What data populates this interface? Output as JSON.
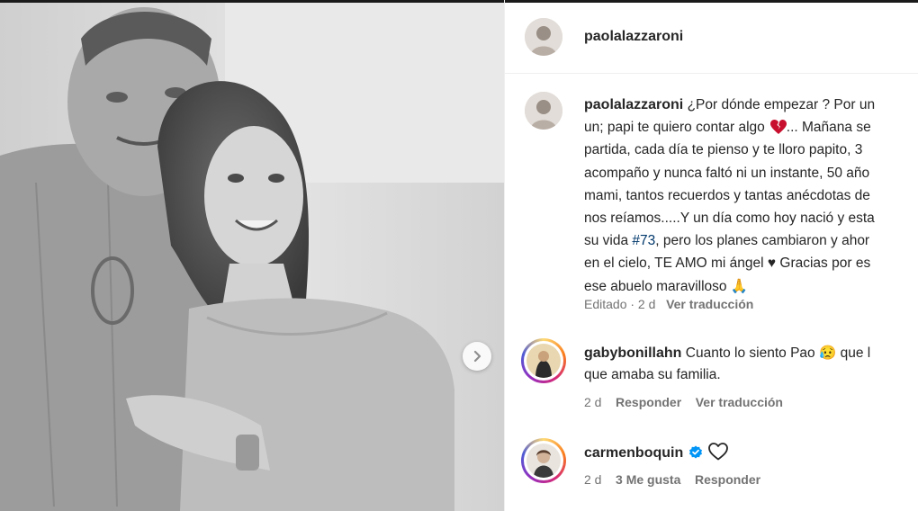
{
  "post": {
    "author": "paolalazzaroni",
    "photo_alt": "Black and white photo of a smiling woman leaning on an older man"
  },
  "caption": {
    "username": "paolalazzaroni",
    "lines": [
      "¿Por dónde empezar ? Por un",
      "un; papi te quiero contar algo",
      "partida, cada día te pienso y te lloro papito, 3",
      "acompaño y nunca faltó ni un instante, 50 año",
      "mami, tantos recuerdos y tantas anécdotas de",
      "nos reíamos.....Y un día como hoy nació y esta",
      "su vida ",
      "en el cielo, TE AMO mi ángel ♥ Gracias por es",
      "ese abuelo maravilloso 🙏"
    ],
    "line2_suffix": "... Mañana se",
    "hashtag": "#73",
    "line7_suffix": ", pero los planes cambiaron y ahor",
    "meta_edited": "Editado · 2 d",
    "meta_translate": "Ver traducción"
  },
  "comments": [
    {
      "username": "gabybonillahn",
      "text_line1": "Cuanto lo siento Pao 😥 que l",
      "text_line2": "que amaba su familia.",
      "time": "2 d",
      "reply": "Responder",
      "translate": "Ver traducción"
    },
    {
      "username": "carmenboquin",
      "time": "2 d",
      "likes": "3 Me gusta",
      "reply": "Responder"
    }
  ],
  "colors": {
    "text": "#262626",
    "muted": "#737373",
    "hashtag": "#00376b",
    "verified": "#0095f6",
    "broken_heart": "#c8102e"
  },
  "icons": [
    "chevron-right-icon",
    "broken-heart-icon",
    "verified-badge-icon",
    "heart-outline-icon"
  ]
}
